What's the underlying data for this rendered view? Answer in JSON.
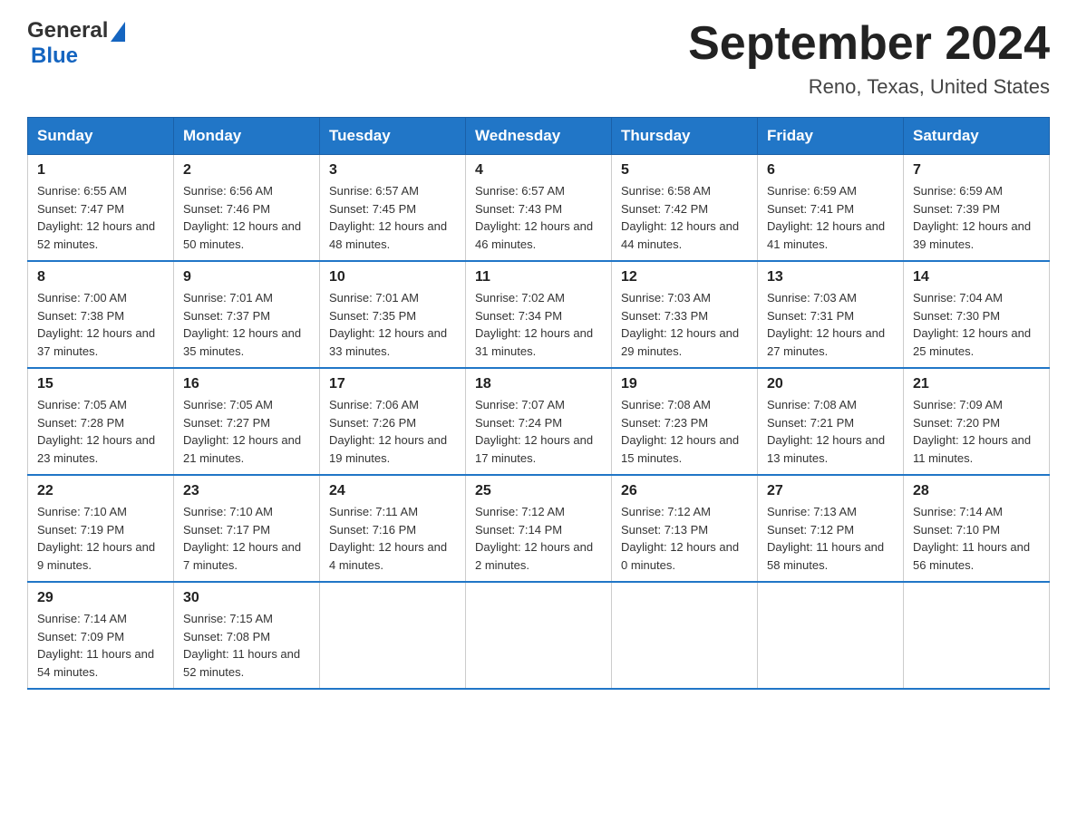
{
  "header": {
    "logo_general": "General",
    "logo_blue": "Blue",
    "title": "September 2024",
    "subtitle": "Reno, Texas, United States"
  },
  "days_of_week": [
    "Sunday",
    "Monday",
    "Tuesday",
    "Wednesday",
    "Thursday",
    "Friday",
    "Saturday"
  ],
  "weeks": [
    [
      {
        "day": "1",
        "sunrise": "Sunrise: 6:55 AM",
        "sunset": "Sunset: 7:47 PM",
        "daylight": "Daylight: 12 hours and 52 minutes."
      },
      {
        "day": "2",
        "sunrise": "Sunrise: 6:56 AM",
        "sunset": "Sunset: 7:46 PM",
        "daylight": "Daylight: 12 hours and 50 minutes."
      },
      {
        "day": "3",
        "sunrise": "Sunrise: 6:57 AM",
        "sunset": "Sunset: 7:45 PM",
        "daylight": "Daylight: 12 hours and 48 minutes."
      },
      {
        "day": "4",
        "sunrise": "Sunrise: 6:57 AM",
        "sunset": "Sunset: 7:43 PM",
        "daylight": "Daylight: 12 hours and 46 minutes."
      },
      {
        "day": "5",
        "sunrise": "Sunrise: 6:58 AM",
        "sunset": "Sunset: 7:42 PM",
        "daylight": "Daylight: 12 hours and 44 minutes."
      },
      {
        "day": "6",
        "sunrise": "Sunrise: 6:59 AM",
        "sunset": "Sunset: 7:41 PM",
        "daylight": "Daylight: 12 hours and 41 minutes."
      },
      {
        "day": "7",
        "sunrise": "Sunrise: 6:59 AM",
        "sunset": "Sunset: 7:39 PM",
        "daylight": "Daylight: 12 hours and 39 minutes."
      }
    ],
    [
      {
        "day": "8",
        "sunrise": "Sunrise: 7:00 AM",
        "sunset": "Sunset: 7:38 PM",
        "daylight": "Daylight: 12 hours and 37 minutes."
      },
      {
        "day": "9",
        "sunrise": "Sunrise: 7:01 AM",
        "sunset": "Sunset: 7:37 PM",
        "daylight": "Daylight: 12 hours and 35 minutes."
      },
      {
        "day": "10",
        "sunrise": "Sunrise: 7:01 AM",
        "sunset": "Sunset: 7:35 PM",
        "daylight": "Daylight: 12 hours and 33 minutes."
      },
      {
        "day": "11",
        "sunrise": "Sunrise: 7:02 AM",
        "sunset": "Sunset: 7:34 PM",
        "daylight": "Daylight: 12 hours and 31 minutes."
      },
      {
        "day": "12",
        "sunrise": "Sunrise: 7:03 AM",
        "sunset": "Sunset: 7:33 PM",
        "daylight": "Daylight: 12 hours and 29 minutes."
      },
      {
        "day": "13",
        "sunrise": "Sunrise: 7:03 AM",
        "sunset": "Sunset: 7:31 PM",
        "daylight": "Daylight: 12 hours and 27 minutes."
      },
      {
        "day": "14",
        "sunrise": "Sunrise: 7:04 AM",
        "sunset": "Sunset: 7:30 PM",
        "daylight": "Daylight: 12 hours and 25 minutes."
      }
    ],
    [
      {
        "day": "15",
        "sunrise": "Sunrise: 7:05 AM",
        "sunset": "Sunset: 7:28 PM",
        "daylight": "Daylight: 12 hours and 23 minutes."
      },
      {
        "day": "16",
        "sunrise": "Sunrise: 7:05 AM",
        "sunset": "Sunset: 7:27 PM",
        "daylight": "Daylight: 12 hours and 21 minutes."
      },
      {
        "day": "17",
        "sunrise": "Sunrise: 7:06 AM",
        "sunset": "Sunset: 7:26 PM",
        "daylight": "Daylight: 12 hours and 19 minutes."
      },
      {
        "day": "18",
        "sunrise": "Sunrise: 7:07 AM",
        "sunset": "Sunset: 7:24 PM",
        "daylight": "Daylight: 12 hours and 17 minutes."
      },
      {
        "day": "19",
        "sunrise": "Sunrise: 7:08 AM",
        "sunset": "Sunset: 7:23 PM",
        "daylight": "Daylight: 12 hours and 15 minutes."
      },
      {
        "day": "20",
        "sunrise": "Sunrise: 7:08 AM",
        "sunset": "Sunset: 7:21 PM",
        "daylight": "Daylight: 12 hours and 13 minutes."
      },
      {
        "day": "21",
        "sunrise": "Sunrise: 7:09 AM",
        "sunset": "Sunset: 7:20 PM",
        "daylight": "Daylight: 12 hours and 11 minutes."
      }
    ],
    [
      {
        "day": "22",
        "sunrise": "Sunrise: 7:10 AM",
        "sunset": "Sunset: 7:19 PM",
        "daylight": "Daylight: 12 hours and 9 minutes."
      },
      {
        "day": "23",
        "sunrise": "Sunrise: 7:10 AM",
        "sunset": "Sunset: 7:17 PM",
        "daylight": "Daylight: 12 hours and 7 minutes."
      },
      {
        "day": "24",
        "sunrise": "Sunrise: 7:11 AM",
        "sunset": "Sunset: 7:16 PM",
        "daylight": "Daylight: 12 hours and 4 minutes."
      },
      {
        "day": "25",
        "sunrise": "Sunrise: 7:12 AM",
        "sunset": "Sunset: 7:14 PM",
        "daylight": "Daylight: 12 hours and 2 minutes."
      },
      {
        "day": "26",
        "sunrise": "Sunrise: 7:12 AM",
        "sunset": "Sunset: 7:13 PM",
        "daylight": "Daylight: 12 hours and 0 minutes."
      },
      {
        "day": "27",
        "sunrise": "Sunrise: 7:13 AM",
        "sunset": "Sunset: 7:12 PM",
        "daylight": "Daylight: 11 hours and 58 minutes."
      },
      {
        "day": "28",
        "sunrise": "Sunrise: 7:14 AM",
        "sunset": "Sunset: 7:10 PM",
        "daylight": "Daylight: 11 hours and 56 minutes."
      }
    ],
    [
      {
        "day": "29",
        "sunrise": "Sunrise: 7:14 AM",
        "sunset": "Sunset: 7:09 PM",
        "daylight": "Daylight: 11 hours and 54 minutes."
      },
      {
        "day": "30",
        "sunrise": "Sunrise: 7:15 AM",
        "sunset": "Sunset: 7:08 PM",
        "daylight": "Daylight: 11 hours and 52 minutes."
      },
      null,
      null,
      null,
      null,
      null
    ]
  ]
}
